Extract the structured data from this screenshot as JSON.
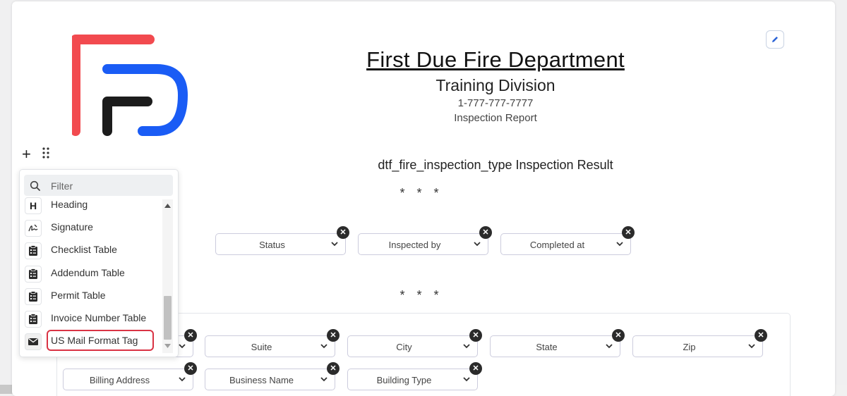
{
  "header": {
    "title": "First Due Fire Department",
    "subtitle": "Training Division",
    "phone": "1-777-777-7777",
    "report": "Inspection Report"
  },
  "section": {
    "heading": "dtf_fire_inspection_type Inspection Result",
    "separator": "* * *"
  },
  "status_fields": [
    {
      "label": "Status"
    },
    {
      "label": "Inspected by"
    },
    {
      "label": "Completed at"
    }
  ],
  "address_fields_row1": [
    {
      "label": ""
    },
    {
      "label": "Suite"
    },
    {
      "label": "City"
    },
    {
      "label": "State"
    },
    {
      "label": "Zip"
    }
  ],
  "address_fields_row2": [
    {
      "label": "Billing Address"
    },
    {
      "label": "Business Name"
    },
    {
      "label": "Building Type"
    }
  ],
  "menu": {
    "filter_placeholder": "Filter",
    "items": [
      {
        "label": "Heading",
        "icon": "heading-icon"
      },
      {
        "label": "Signature",
        "icon": "signature-icon"
      },
      {
        "label": "Checklist Table",
        "icon": "clipboard-icon"
      },
      {
        "label": "Addendum Table",
        "icon": "clipboard-icon"
      },
      {
        "label": "Permit Table",
        "icon": "clipboard-icon"
      },
      {
        "label": "Invoice Number Table",
        "icon": "clipboard-icon"
      },
      {
        "label": "US Mail Format Tag",
        "icon": "mail-icon"
      }
    ],
    "selected": "US Mail Format Tag"
  },
  "colors": {
    "logo_red": "#f24a4f",
    "logo_blue": "#1a5cf5",
    "logo_black": "#1c1c1c",
    "highlight": "#d93344"
  }
}
